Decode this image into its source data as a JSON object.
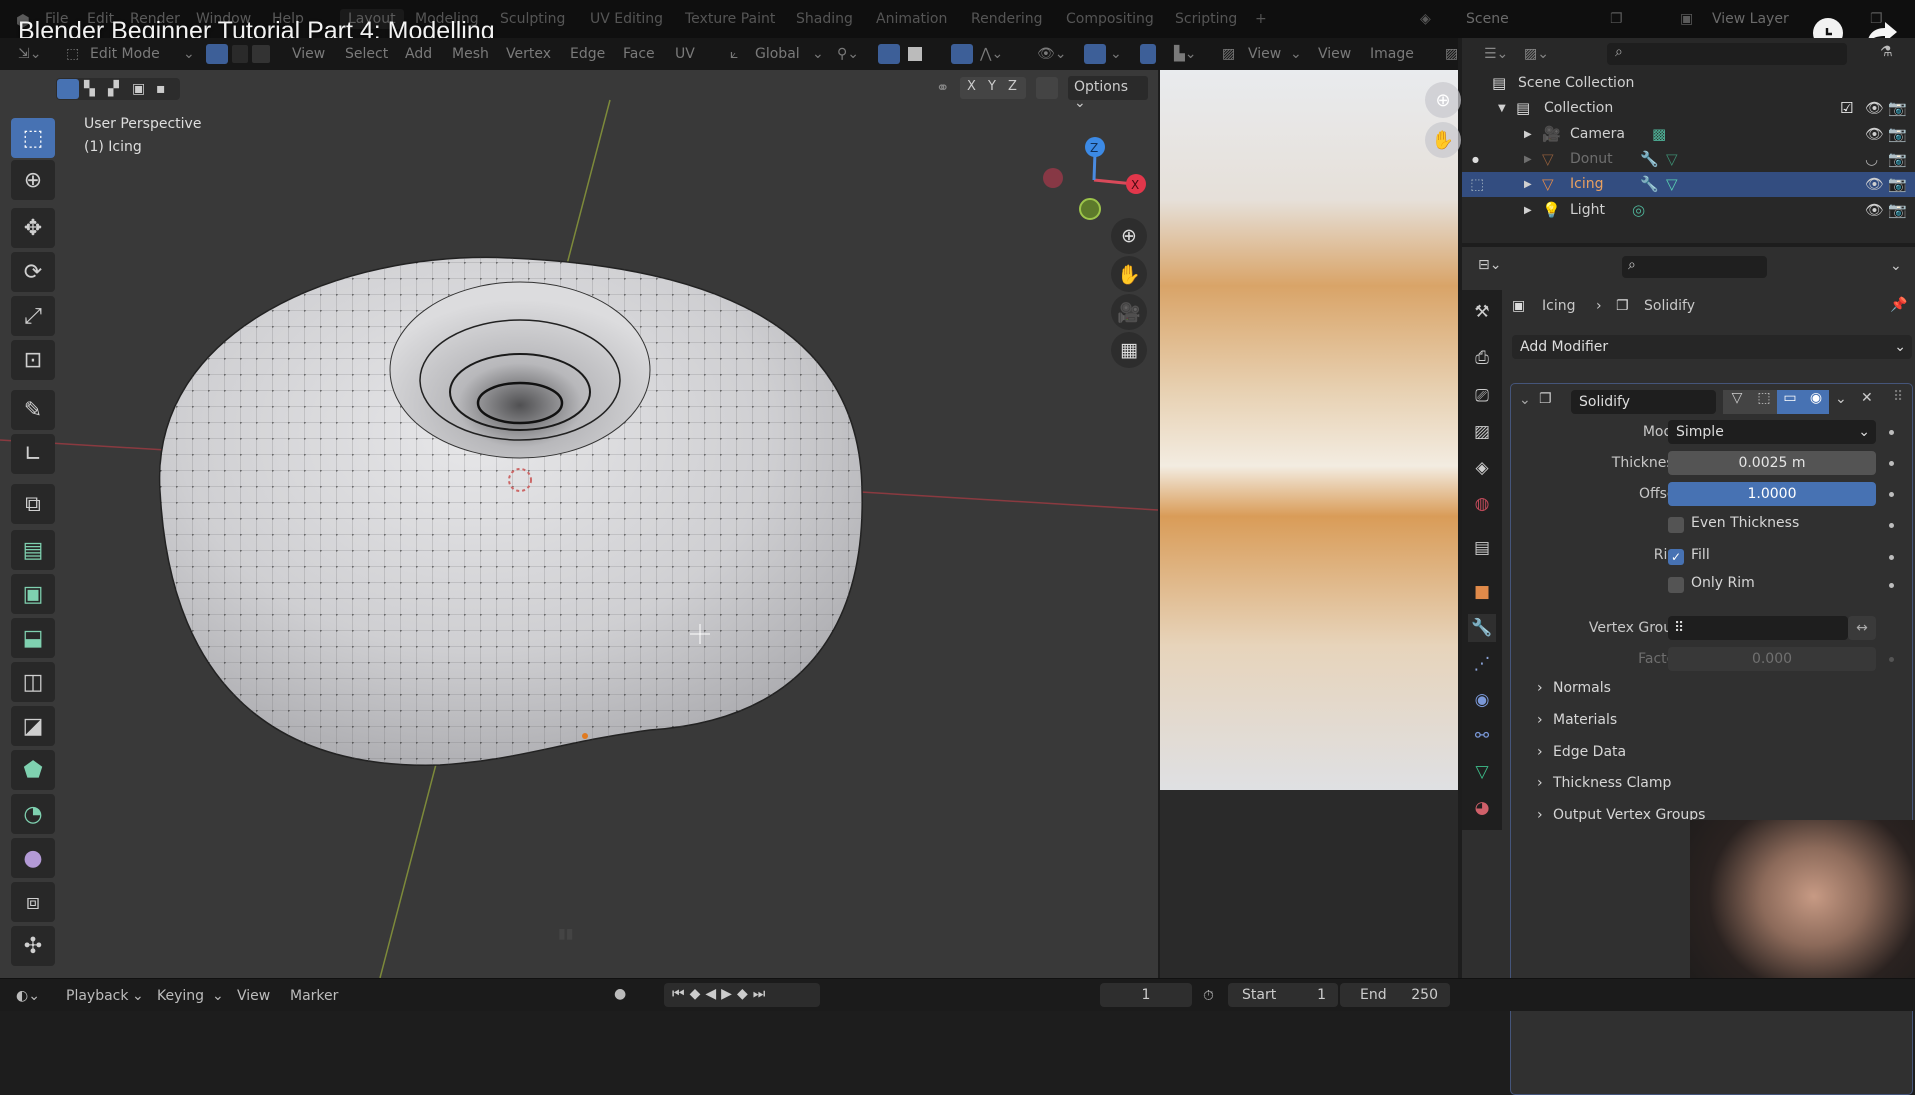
{
  "video": {
    "title": "Blender Beginner Tutorial Part 4: Modelling",
    "watch_later_icon": "clock-icon",
    "share_icon": "share-arrow-icon"
  },
  "topbar": {
    "menus": [
      "File",
      "Edit",
      "Render",
      "Window",
      "Help"
    ],
    "workspaces": [
      "Layout",
      "Modeling",
      "Sculpting",
      "UV Editing",
      "Texture Paint",
      "Shading",
      "Animation",
      "Rendering",
      "Compositing",
      "Scripting"
    ],
    "active_workspace": "Layout",
    "add_workspace": "+",
    "scene": "Scene",
    "view_layer": "View Layer"
  },
  "viewport_header": {
    "mode": "Edit Mode",
    "menus": [
      "View",
      "Select",
      "Add",
      "Mesh",
      "Vertex",
      "Edge",
      "Face",
      "UV"
    ],
    "transform_orientation": "Global",
    "axes": [
      "X",
      "Y",
      "Z"
    ],
    "options_label": "Options"
  },
  "viewport": {
    "view_name": "User Perspective",
    "object_info": "(1) Icing",
    "gizmo_axes": {
      "z": "Z",
      "x": "X"
    },
    "colors": {
      "x_axis": "#e2374b",
      "y_axis": "#84a13b",
      "z_axis": "#3c8ae5",
      "mesh": "#cfcfd1",
      "background": "#393939"
    }
  },
  "toolbar": {
    "tools": [
      "select-box",
      "cursor",
      "move",
      "rotate",
      "scale",
      "transform",
      "annotate",
      "measure",
      "add-cube",
      "extrude-region",
      "inset-faces",
      "bevel",
      "loop-cut",
      "knife",
      "poly-build",
      "spin",
      "smooth",
      "shrink-fatten",
      "shear"
    ],
    "active_tool": "select-box"
  },
  "image_editor": {
    "menus": [
      "View",
      "View",
      "Image"
    ]
  },
  "outliner": {
    "root": "Scene Collection",
    "collection": "Collection",
    "items": [
      {
        "name": "Camera",
        "type": "camera",
        "visible": true,
        "selected": false
      },
      {
        "name": "Donut",
        "type": "mesh",
        "visible": false,
        "selected": false
      },
      {
        "name": "Icing",
        "type": "mesh",
        "visible": true,
        "selected": true
      },
      {
        "name": "Light",
        "type": "light",
        "visible": true,
        "selected": false
      }
    ]
  },
  "properties": {
    "breadcrumb": [
      "Icing",
      "Solidify"
    ],
    "add_modifier_label": "Add Modifier",
    "modifier": {
      "name": "Solidify",
      "fields": {
        "mode_label": "Mode",
        "mode_value": "Simple",
        "thickness_label": "Thickness",
        "thickness_value": "0.0025 m",
        "offset_label": "Offset",
        "offset_value": "1.0000",
        "even_thickness_label": "Even Thickness",
        "even_thickness_checked": false,
        "rim_label": "Rim",
        "fill_label": "Fill",
        "fill_checked": true,
        "only_rim_label": "Only Rim",
        "only_rim_checked": false,
        "vertex_group_label": "Vertex Group",
        "vertex_group_value": "",
        "factor_label": "Factor",
        "factor_value": "0.000"
      },
      "subpanels": [
        "Normals",
        "Materials",
        "Edge Data",
        "Thickness Clamp",
        "Output Vertex Groups"
      ]
    },
    "tabs": [
      "tool",
      "render",
      "output",
      "view-layer",
      "scene",
      "world",
      "collection",
      "object",
      "modifiers",
      "particles",
      "physics",
      "constraints",
      "data",
      "material"
    ],
    "active_tab": "modifiers",
    "accent": "#4772b3"
  },
  "timeline": {
    "menus": [
      "Playback",
      "Keying",
      "View",
      "Marker"
    ],
    "current_frame": "1",
    "start_label": "Start",
    "start_value": "1",
    "end_label": "End",
    "end_value": "250"
  }
}
